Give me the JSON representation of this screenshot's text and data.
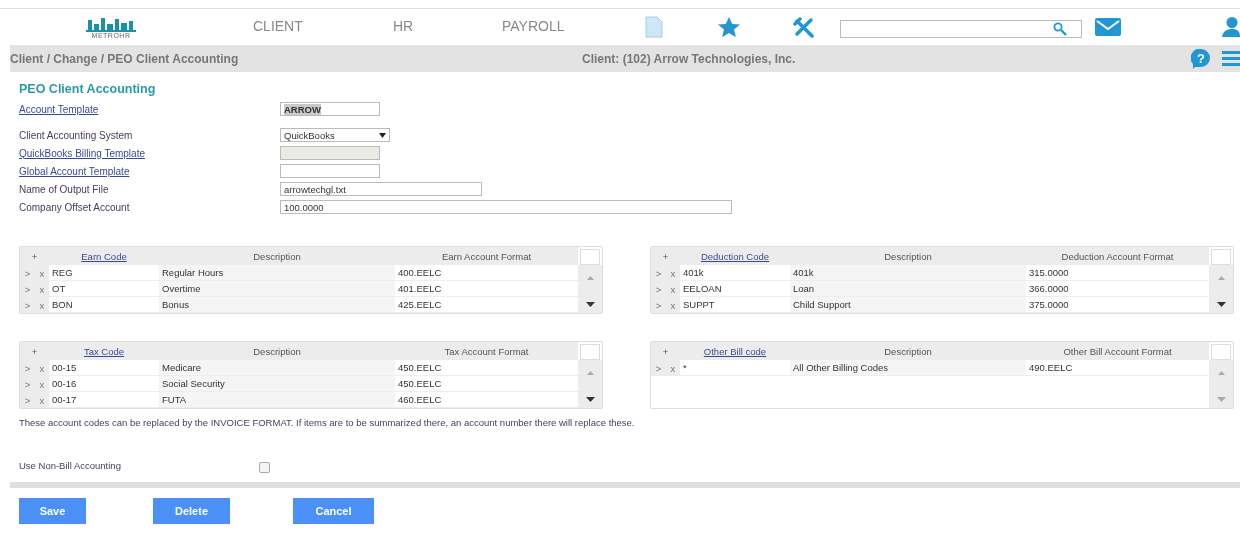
{
  "header": {
    "logo_text": "METROHR",
    "nav": [
      "CLIENT",
      "HR",
      "PAYROLL"
    ]
  },
  "breadcrumb": {
    "path": "Client / Change / PEO Client Accounting",
    "client": "Client: (102) Arrow Technologies, Inc.",
    "help": "?"
  },
  "form": {
    "title": "PEO Client Accounting",
    "fields": [
      {
        "label": "Account Template",
        "link": true,
        "kind": "text",
        "value": "ARROW",
        "disabled": false,
        "highlighted": true
      },
      {
        "label": "Client Accounting System",
        "link": false,
        "kind": "select",
        "value": "QuickBooks",
        "disabled": false
      },
      {
        "label": "QuickBooks Billing Template",
        "link": true,
        "kind": "text",
        "disabled": true
      },
      {
        "label": "Global Account Template",
        "link": true,
        "kind": "text",
        "disabled": false
      },
      {
        "label": "Name of Output File",
        "link": false,
        "kind": "text",
        "value": "arrowtechgl.txt",
        "disabled": false
      },
      {
        "label": "Company Offset Account",
        "link": false,
        "kind": "text",
        "value": "100.0000",
        "disabled": false
      }
    ]
  },
  "tables": [
    {
      "add": "+",
      "columns": [
        "Earn Code",
        "Description",
        "Earn Account Format"
      ],
      "rows": [
        {
          "open": ">",
          "remove": "x",
          "cells": [
            "REG",
            "Regular Hours",
            "400.EELC"
          ]
        },
        {
          "open": ">",
          "remove": "x",
          "cells": [
            "OT",
            "Overtime",
            "401.EELC"
          ]
        },
        {
          "open": ">",
          "remove": "x",
          "cells": [
            "BON",
            "Bonus",
            "425.EELC"
          ]
        }
      ]
    },
    {
      "add": "+",
      "columns": [
        "Deduction Code",
        "Description",
        "Deduction Account Format"
      ],
      "rows": [
        {
          "open": ">",
          "remove": "x",
          "cells": [
            "401k",
            "401k",
            "315.0000"
          ]
        },
        {
          "open": ">",
          "remove": "x",
          "cells": [
            "EELOAN",
            "Loan",
            "366.0000"
          ]
        },
        {
          "open": ">",
          "remove": "x",
          "cells": [
            "SUPPT",
            "Child Support",
            "375.0000"
          ]
        }
      ]
    },
    {
      "add": "+",
      "columns": [
        "Tax Code",
        "Description",
        "Tax Account Format"
      ],
      "rows": [
        {
          "open": ">",
          "remove": "x",
          "cells": [
            "00-15",
            "Medicare",
            "450.EELC"
          ]
        },
        {
          "open": ">",
          "remove": "x",
          "cells": [
            "00-16",
            "Social Security",
            "450.EELC"
          ]
        },
        {
          "open": ">",
          "remove": "x",
          "cells": [
            "00-17",
            "FUTA",
            "460.EELC"
          ]
        }
      ]
    },
    {
      "add": "+",
      "columns": [
        "Other Bill code",
        "Description",
        "Other Bill Account Format"
      ],
      "rows": [
        {
          "open": ">",
          "remove": "x",
          "cells": [
            "*",
            "All Other Billing Codes",
            "490.EELC"
          ]
        }
      ]
    }
  ],
  "note": "These account codes can be replaced by the INVOICE FORMAT. If items are to be summarized there, an account number there will replace these.",
  "non_bill": {
    "label": "Use Non-Bill Accounting",
    "checked": false
  },
  "buttons": [
    "Save",
    "Delete",
    "Cancel"
  ]
}
